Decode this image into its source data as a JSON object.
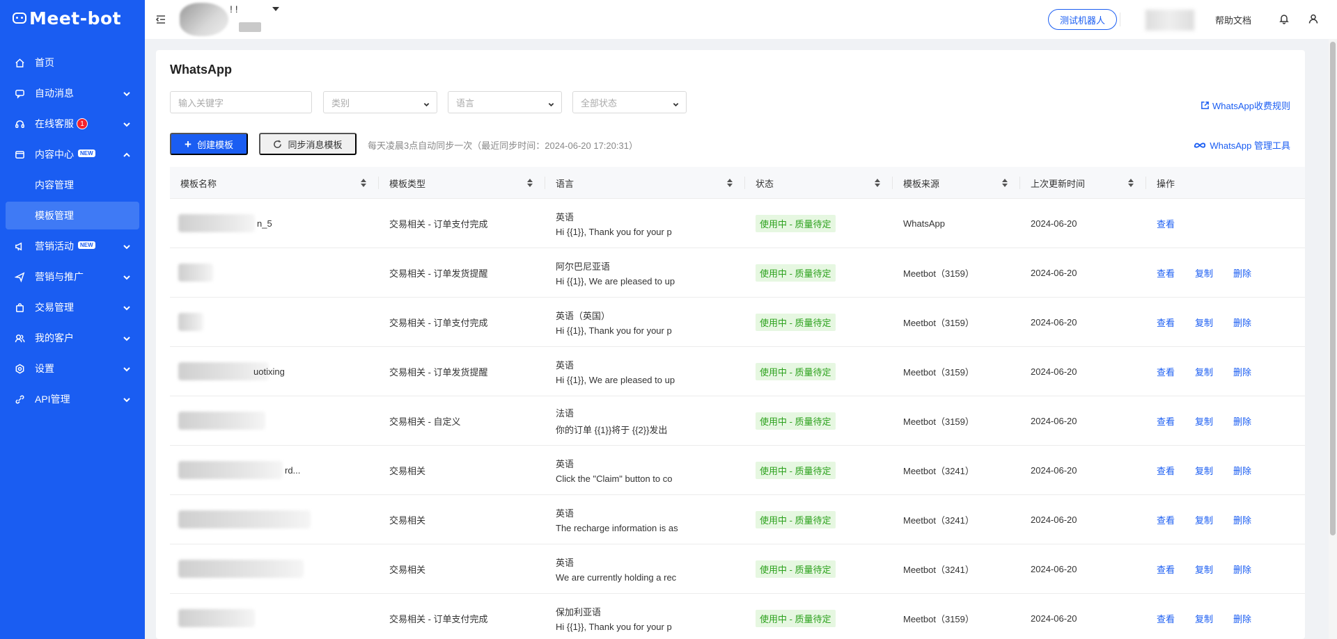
{
  "app": {
    "logo": "Meet-bot"
  },
  "sidebar": {
    "items": [
      {
        "label": "首页",
        "icon": "home-icon"
      },
      {
        "label": "自动消息",
        "icon": "message-icon"
      },
      {
        "label": "在线客服",
        "icon": "headset-icon",
        "badge": "1"
      },
      {
        "label": "内容中心",
        "icon": "content-icon",
        "badge": "NEW",
        "sub": [
          {
            "label": "内容管理"
          },
          {
            "label": "模板管理"
          }
        ]
      },
      {
        "label": "营销活动",
        "icon": "megaphone-icon",
        "badge": "NEW"
      },
      {
        "label": "营销与推广",
        "icon": "send-icon"
      },
      {
        "label": "交易管理",
        "icon": "bag-icon"
      },
      {
        "label": "我的客户",
        "icon": "users-icon"
      },
      {
        "label": "设置",
        "icon": "settings-icon"
      },
      {
        "label": "API管理",
        "icon": "api-icon"
      }
    ]
  },
  "header": {
    "account_name": "! !",
    "test_button": "测试机器人",
    "help": "帮助文档"
  },
  "page": {
    "title": "WhatsApp",
    "filters": {
      "keyword_placeholder": "输入关键字",
      "category": "类别",
      "language": "语言",
      "status": "全部状态"
    },
    "rule_link": "WhatsApp收费规则",
    "create_button": "创建模板",
    "sync_button": "同步消息模板",
    "sync_note": "每天凌晨3点自动同步一次（最近同步时间：2024-06-20 17:20:31）",
    "tool_link": "WhatsApp 管理工具"
  },
  "table": {
    "columns": [
      "模板名称",
      "模板类型",
      "语言",
      "状态",
      "模板来源",
      "上次更新时间",
      "操作"
    ],
    "actions": {
      "view": "查看",
      "copy": "复制",
      "delete": "删除"
    },
    "rows": [
      {
        "name_suffix": "n_5",
        "type": "交易相关 - 订单支付完成",
        "lang": "英语",
        "preview": "Hi {{1}}, Thank you for your p",
        "status": "使用中 - 质量待定",
        "source": "WhatsApp",
        "updated": "2024-06-20"
      },
      {
        "name_suffix": "",
        "type": "交易相关 - 订单发货提醒",
        "lang": "阿尔巴尼亚语",
        "preview": "Hi {{1}}, We are pleased to up",
        "status": "使用中 - 质量待定",
        "source": "Meetbot（3159）",
        "updated": "2024-06-20"
      },
      {
        "name_suffix": "",
        "type": "交易相关 - 订单支付完成",
        "lang": "英语（英国）",
        "preview": "Hi {{1}}, Thank you for your p",
        "status": "使用中 - 质量待定",
        "source": "Meetbot（3159）",
        "updated": "2024-06-20"
      },
      {
        "name_suffix": "uotixing",
        "type": "交易相关 - 订单发货提醒",
        "lang": "英语",
        "preview": "Hi {{1}}, We are pleased to up",
        "status": "使用中 - 质量待定",
        "source": "Meetbot（3159）",
        "updated": "2024-06-20"
      },
      {
        "name_suffix": "",
        "type": "交易相关 - 自定义",
        "lang": "法语",
        "preview": "你的订单 {{1}}将于 {{2}}发出",
        "status": "使用中 - 质量待定",
        "source": "Meetbot（3159）",
        "updated": "2024-06-20"
      },
      {
        "name_suffix": "rd...",
        "type": "交易相关",
        "lang": "英语",
        "preview": "Click the \"Claim\" button to co",
        "status": "使用中 - 质量待定",
        "source": "Meetbot（3241）",
        "updated": "2024-06-20"
      },
      {
        "name_suffix": "",
        "type": "交易相关",
        "lang": "英语",
        "preview": "The recharge information is as",
        "status": "使用中 - 质量待定",
        "source": "Meetbot（3241）",
        "updated": "2024-06-20"
      },
      {
        "name_suffix": "",
        "type": "交易相关",
        "lang": "英语",
        "preview": "We are currently holding a rec",
        "status": "使用中 - 质量待定",
        "source": "Meetbot（3241）",
        "updated": "2024-06-20"
      },
      {
        "name_suffix": "",
        "type": "交易相关 - 订单支付完成",
        "lang": "保加利亚语",
        "preview": "Hi {{1}}, Thank you for your p",
        "status": "使用中 - 质量待定",
        "source": "Meetbot（3159）",
        "updated": "2024-06-20"
      }
    ]
  }
}
